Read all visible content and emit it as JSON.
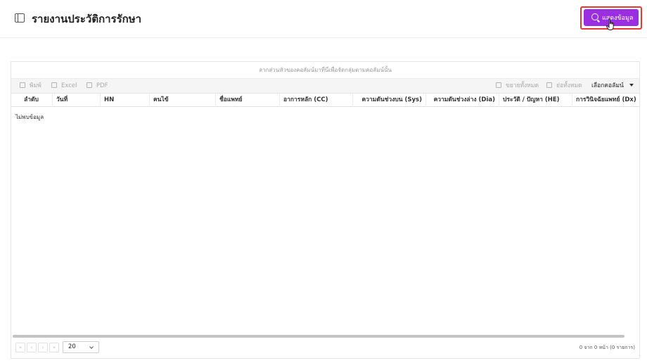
{
  "header": {
    "title": "รายงานประวัติการรักษา",
    "show_button_label": "แสดงข้อมูล"
  },
  "grid": {
    "group_panel_hint": "ลากส่วนหัวของคอลัมน์มาที่นี่เพื่อจัดกลุ่มตามคอลัมน์นั้น",
    "toolbar": {
      "print": "พิมพ์",
      "excel": "Excel",
      "pdf": "PDF",
      "expand_all": "ขยายทั้งหมด",
      "collapse_all": "ย่อทั้งหมด",
      "select_columns": "เลือกคอลัมน์"
    },
    "columns": [
      "ลำดับ",
      "วันที่",
      "HN",
      "คนไข้",
      "ชื่อแพทย์",
      "อาการหลัก (CC)",
      "ความดันช่วงบน (Sys)",
      "ความดันช่วงล่าง (Dia)",
      "ประวัติ / ปัญหา (HE)",
      "การวินิจฉัยแพทย์ (Dx)"
    ],
    "no_data_text": "ไม่พบข้อมูล",
    "pager": {
      "first": "«",
      "prev": "‹",
      "next": "›",
      "last": "»",
      "page_size": "20",
      "status": "0 จาก 0 หน้า (0 รายการ)"
    }
  },
  "colors": {
    "accent": "#9b2ee0",
    "highlight": "#e53935"
  }
}
